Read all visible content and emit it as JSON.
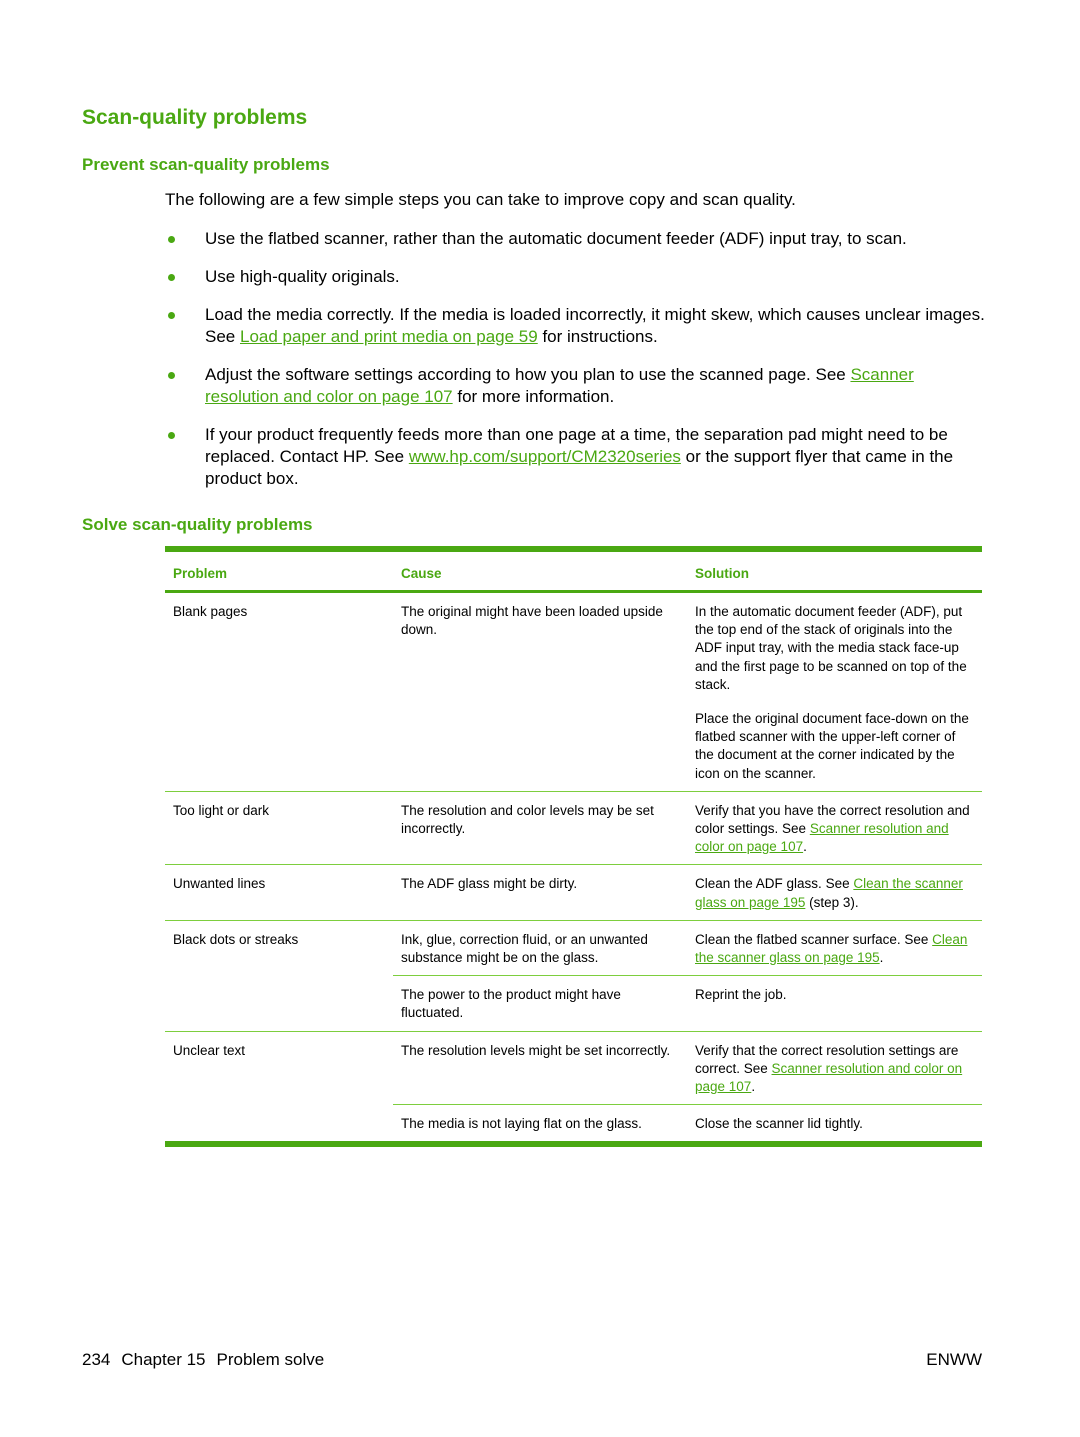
{
  "title": "Scan-quality problems",
  "prevent": {
    "heading": "Prevent scan-quality problems",
    "intro": "The following are a few simple steps you can take to improve copy and scan quality.",
    "bullets": [
      {
        "text": "Use the flatbed scanner, rather than the automatic document feeder (ADF) input tray, to scan."
      },
      {
        "text": "Use high-quality originals."
      },
      {
        "before": "Load the media correctly. If the media is loaded incorrectly, it might skew, which causes unclear images. See ",
        "link": "Load paper and print media on page 59",
        "after": " for instructions."
      },
      {
        "before": "Adjust the software settings according to how you plan to use the scanned page. See ",
        "link": "Scanner resolution and color on page 107",
        "after": " for more information."
      },
      {
        "before": "If your product frequently feeds more than one page at a time, the separation pad might need to be replaced. Contact HP. See ",
        "link": "www.hp.com/support/CM2320series",
        "after": " or the support flyer that came in the product box."
      }
    ]
  },
  "solve": {
    "heading": "Solve scan-quality problems",
    "columns": [
      "Problem",
      "Cause",
      "Solution"
    ],
    "rows": [
      {
        "problem": "Blank pages",
        "cause": "The original might have been loaded upside down.",
        "solution1": "In the automatic document feeder (ADF), put the top end of the stack of originals into the ADF input tray, with the media stack face-up and the first page to be scanned on top of the stack.",
        "solution2": "Place the original document face-down on the flatbed scanner with the upper-left corner of the document at the corner indicated by the icon on the scanner."
      },
      {
        "problem": "Too light or dark",
        "cause": "The resolution and color levels may be set incorrectly.",
        "sol_before": "Verify that you have the correct resolution and color settings. See ",
        "sol_link": "Scanner resolution and color on page 107",
        "sol_after": "."
      },
      {
        "problem": "Unwanted lines",
        "cause": "The ADF glass might be dirty.",
        "sol_before": "Clean the ADF glass. See ",
        "sol_link": "Clean the scanner glass on page 195",
        "sol_after": " (step 3)."
      },
      {
        "problem": "Black dots or streaks",
        "cause": "Ink, glue, correction fluid, or an unwanted substance might be on the glass.",
        "sol_before": "Clean the flatbed scanner surface. See ",
        "sol_link": "Clean the scanner glass on page 195",
        "sol_after": "."
      },
      {
        "problem": "",
        "cause": "The power to the product might have fluctuated.",
        "solution": "Reprint the job."
      },
      {
        "problem": "Unclear text",
        "cause": "The resolution levels might be set incorrectly.",
        "sol_before": "Verify that the correct resolution settings are correct. See ",
        "sol_link": "Scanner resolution and color on page 107",
        "sol_after": "."
      },
      {
        "problem": "",
        "cause": "The media is not laying flat on the glass.",
        "solution": "Close the scanner lid tightly."
      }
    ]
  },
  "footer": {
    "page": "234",
    "chapter": "Chapter 15",
    "section": "Problem solve",
    "right": "ENWW"
  },
  "colors": {
    "accent": "#4aa812"
  }
}
